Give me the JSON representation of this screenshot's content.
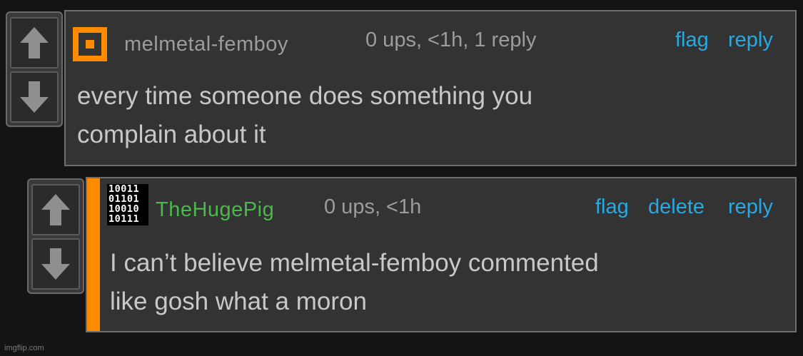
{
  "comments": [
    {
      "username": "melmetal-femboy",
      "username_color": "#9c9c9c",
      "avatar": "orange-pixel-square",
      "meta": "0 ups, <1h, 1 reply",
      "actions": [
        "flag",
        "reply"
      ],
      "text_line1": "every time someone does something you",
      "text_line2": "complain about it"
    },
    {
      "username": "TheHugePig",
      "username_color": "#4cb84c",
      "avatar": "binary-digits",
      "avatar_rows": [
        "10011",
        "01101",
        "10010",
        "10111"
      ],
      "meta": "0 ups, <1h",
      "actions": [
        "flag",
        "delete",
        "reply"
      ],
      "text_line1": "I can’t believe melmetal-femboy commented",
      "text_line2": "like gosh what a moron"
    }
  ],
  "icons": {
    "upvote": "arrow-up-icon",
    "downvote": "arrow-down-icon"
  },
  "colors": {
    "action": "#2aa8e0",
    "op_marker": "#ff8a00",
    "background": "#141414",
    "panel": "#333333"
  },
  "watermark": "imgflip.com"
}
